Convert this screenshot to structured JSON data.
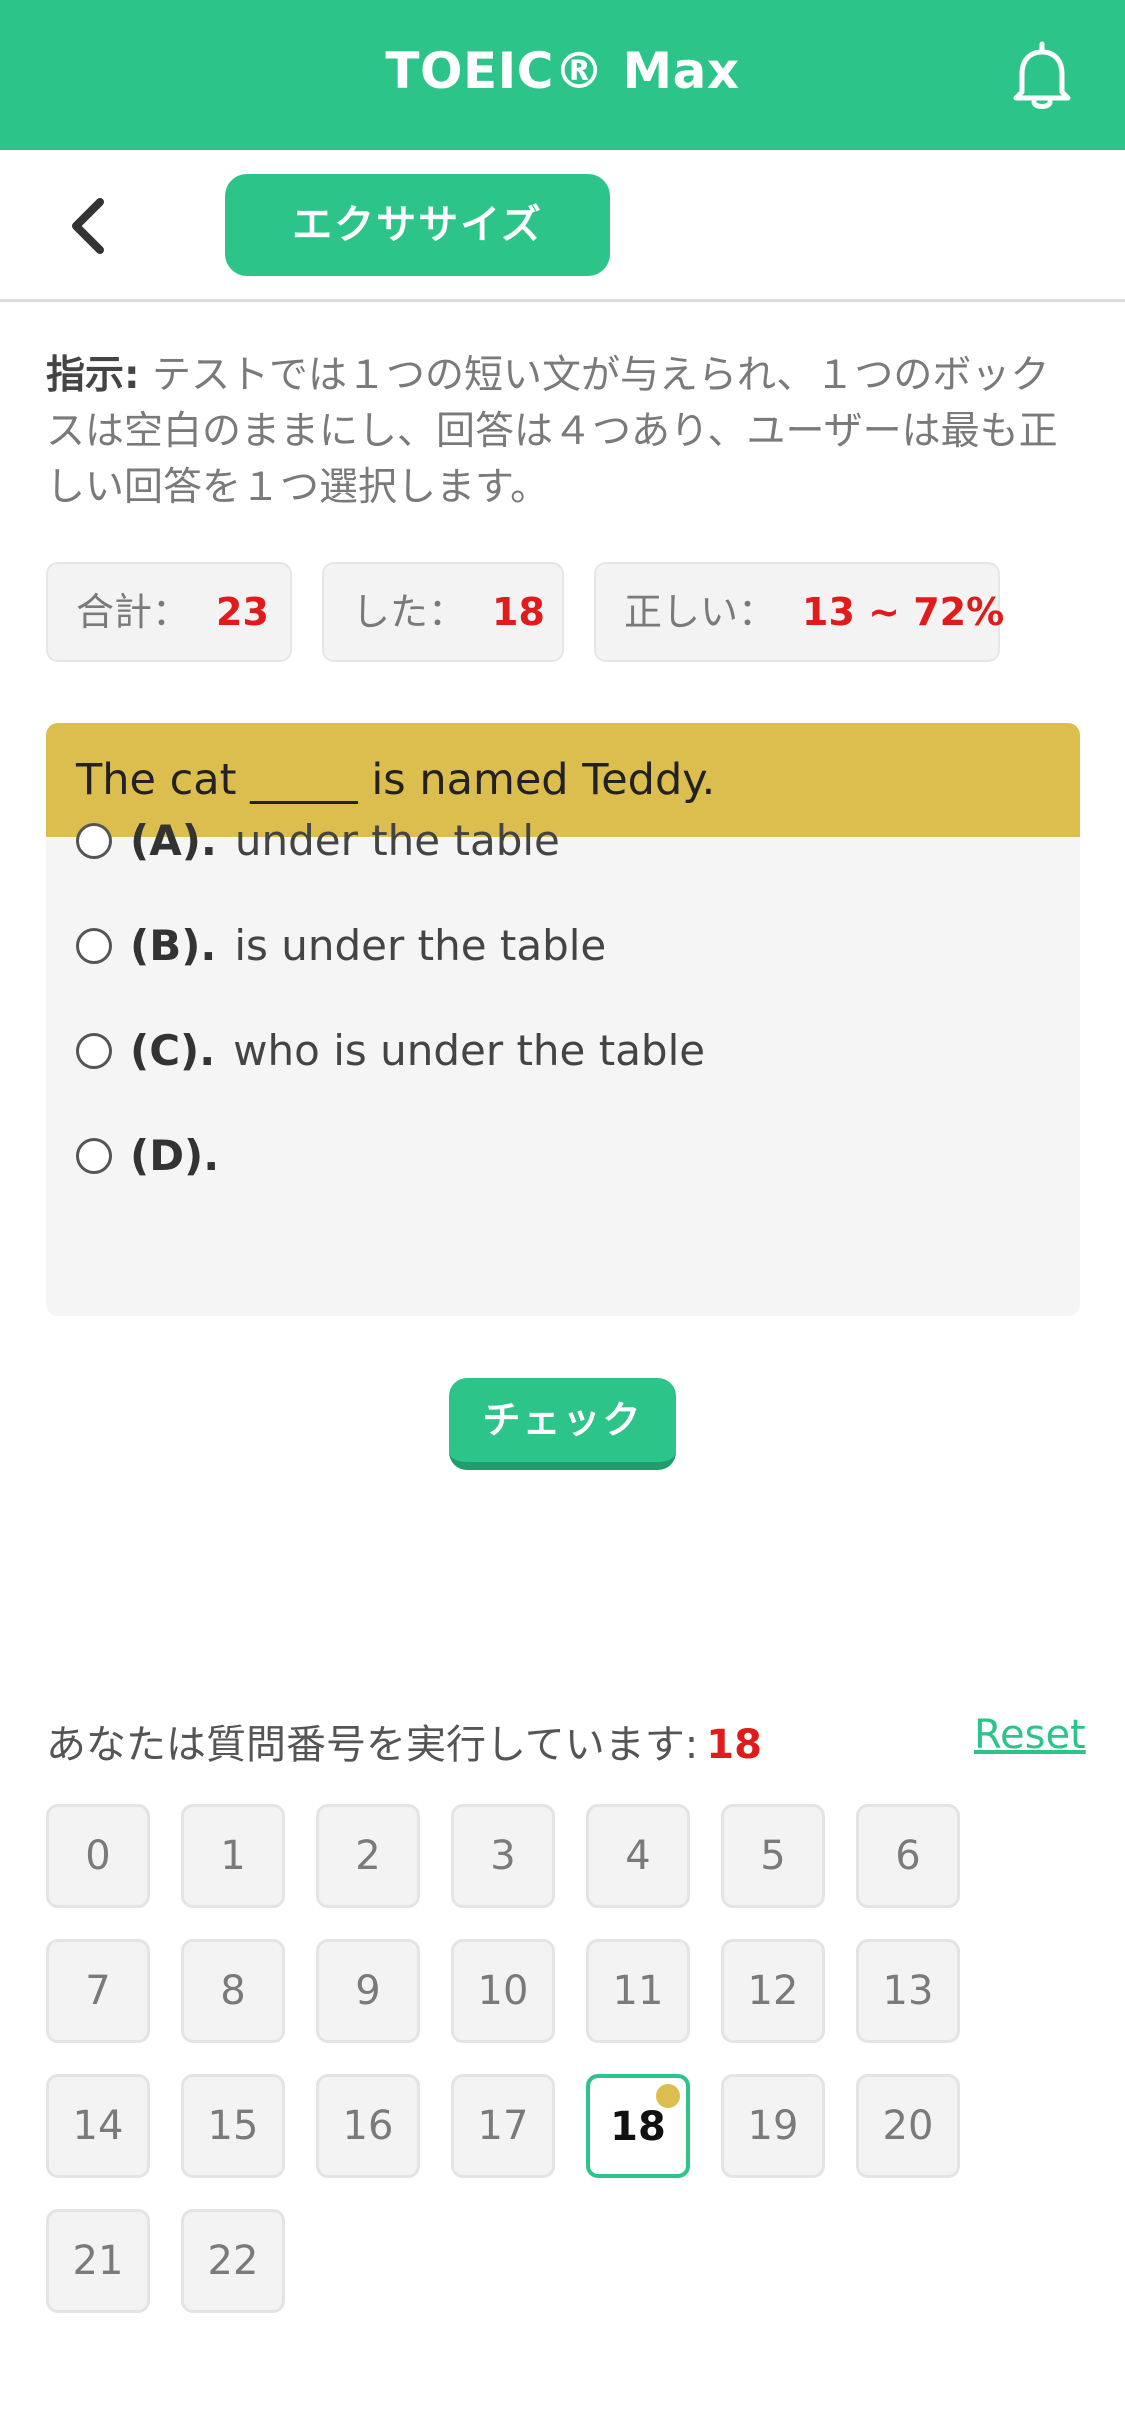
{
  "header": {
    "title": "TOEIC® Max"
  },
  "subbar": {
    "tab_label": "エクササイズ"
  },
  "instructions": {
    "label": "指示:",
    "text": " テストでは１つの短い文が与えられ、１つのボックスは空白のままにし、回答は４つあり、ユーザーは最も正しい回答を１つ選択します。"
  },
  "stats": {
    "total_label": "合計：",
    "total_value": "23",
    "done_label": "した：",
    "done_value": "18",
    "correct_label": "正しい：",
    "correct_value": "13 ~ 72%"
  },
  "question": {
    "text": "The cat _____ is named Teddy.",
    "options": [
      {
        "letter": "(A).",
        "text": "under the table"
      },
      {
        "letter": "(B).",
        "text": "is under the table"
      },
      {
        "letter": "(C).",
        "text": "who is under the table"
      },
      {
        "letter": "(D).",
        "text": ""
      }
    ]
  },
  "check_button": "チェック",
  "progress": {
    "label": "あなたは質問番号を実行しています:",
    "current": "18",
    "reset_label": "Reset"
  },
  "question_numbers": [
    "0",
    "1",
    "2",
    "3",
    "4",
    "5",
    "6",
    "7",
    "8",
    "9",
    "10",
    "11",
    "12",
    "13",
    "14",
    "15",
    "16",
    "17",
    "18",
    "19",
    "20",
    "21",
    "22"
  ],
  "colors": {
    "brand": "#2dc48a",
    "question_header": "#dbbe4d",
    "highlight": "#e01b1b"
  }
}
